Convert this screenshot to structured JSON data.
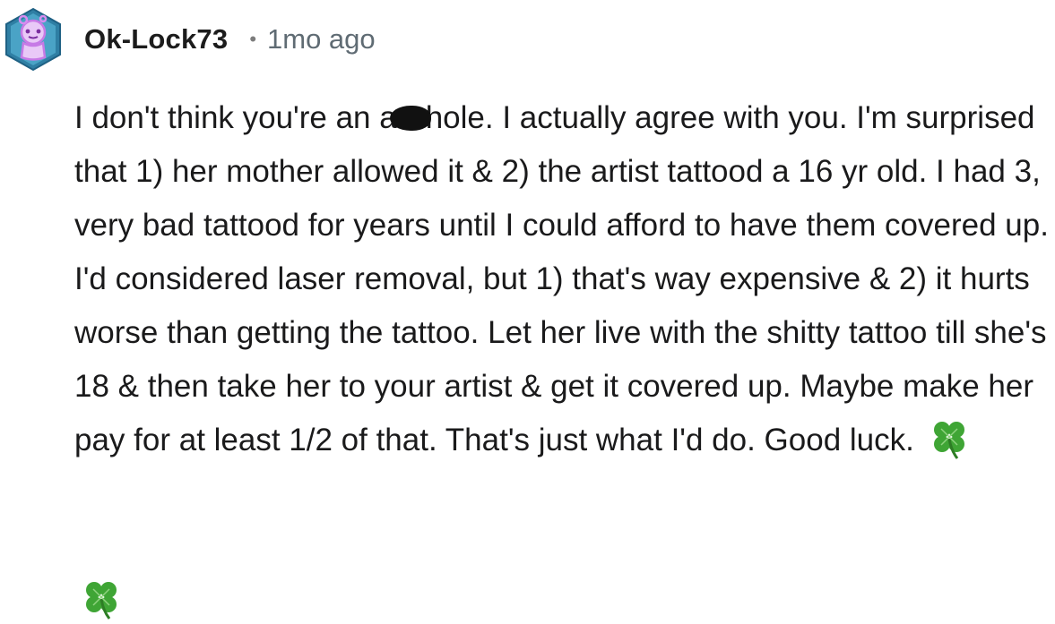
{
  "comment": {
    "author": "Ok-Lock73",
    "separator": "•",
    "timestamp": "1mo ago",
    "body_part1": "I don't think you're an a",
    "redacted_word_note_icon": "scribble-redaction",
    "body_part2": "hole. I actually agree with you. I'm surprised that 1) her mother allowed it & 2) the artist tattood a 16 yr old. I had 3, very bad tattood for years until I could afford to have them covered up. I'd considered laser removal, but 1) that's way expensive & 2) it hurts worse than getting the tattoo. Let her live with the shitty tattoo till she's 18 & then take her to your artist & get it covered up. Maybe make her pay for at least 1/2 of that. That's just what I'd do. Good luck.",
    "emoji_icon": "four-leaf-clover-icon"
  },
  "colors": {
    "text": "#1a1a1b",
    "meta": "#5f6b73",
    "avatar_bg": "#3b8fb0",
    "avatar_outline": "#d78cf0",
    "clover": "#3fa535"
  }
}
